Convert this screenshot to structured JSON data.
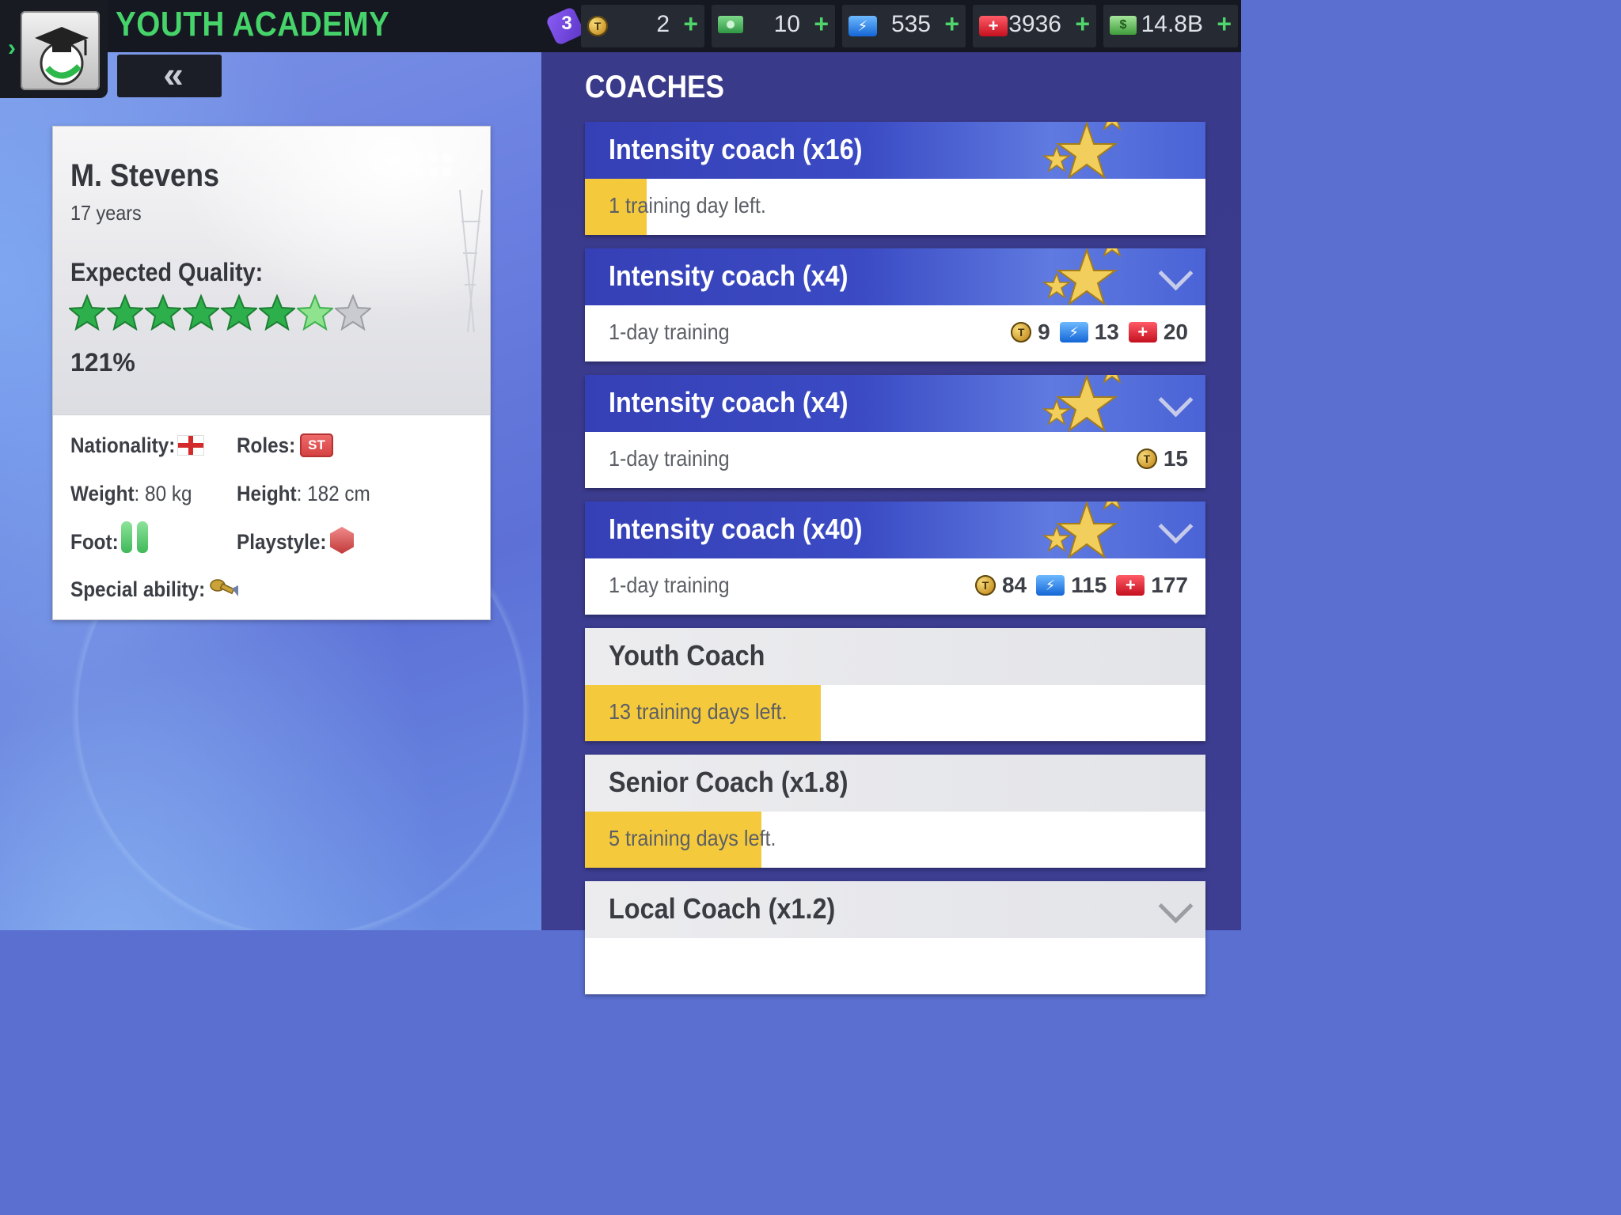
{
  "header": {
    "title": "YOUTH ACADEMY",
    "promo_count": "3",
    "currencies": [
      {
        "name": "tokens",
        "value": "2"
      },
      {
        "name": "cash",
        "value": "10"
      },
      {
        "name": "energy",
        "value": "535"
      },
      {
        "name": "medical",
        "value": "3936"
      },
      {
        "name": "money",
        "value": "14.8B"
      }
    ],
    "plus_label": "+",
    "back_label": "«"
  },
  "player": {
    "name": "M. Stevens",
    "age": "17 years",
    "expected_quality_label": "Expected Quality:",
    "stars_filled": 6,
    "stars_half": 1,
    "stars_total": 8,
    "quality_percent": "121%",
    "nationality_label": "Nationality:",
    "roles_label": "Roles:",
    "role": "ST",
    "weight_label": "Weight",
    "weight_value": ": 80 kg",
    "height_label": "Height",
    "height_value": ": 182 cm",
    "foot_label": "Foot:",
    "playstyle_label": "Playstyle:",
    "special_ability_label": "Special ability:"
  },
  "coaches": {
    "title": "COACHES",
    "items": [
      {
        "name": "Intensity coach (x16)",
        "sub": "1 training day left.",
        "progress": 0.1
      },
      {
        "name": "Intensity coach (x4)",
        "sub": "1-day training",
        "costs": {
          "tokens": "9",
          "energy": "13",
          "medical": "20"
        }
      },
      {
        "name": "Intensity coach (x4)",
        "sub": "1-day training",
        "costs": {
          "tokens": "15"
        }
      },
      {
        "name": "Intensity coach (x40)",
        "sub": "1-day training",
        "costs": {
          "tokens": "84",
          "energy": "115",
          "medical": "177"
        }
      },
      {
        "name": "Youth Coach",
        "sub": "13 training days left.",
        "progress": 0.38
      },
      {
        "name": "Senior Coach (x1.8)",
        "sub": "5 training days left.",
        "progress": 0.285
      },
      {
        "name": "Local Coach (x1.2)"
      }
    ]
  },
  "colors": {
    "accent_green": "#46d36a",
    "progress_yellow": "#f4c93c",
    "coach_header_blue": "#3640b6"
  }
}
